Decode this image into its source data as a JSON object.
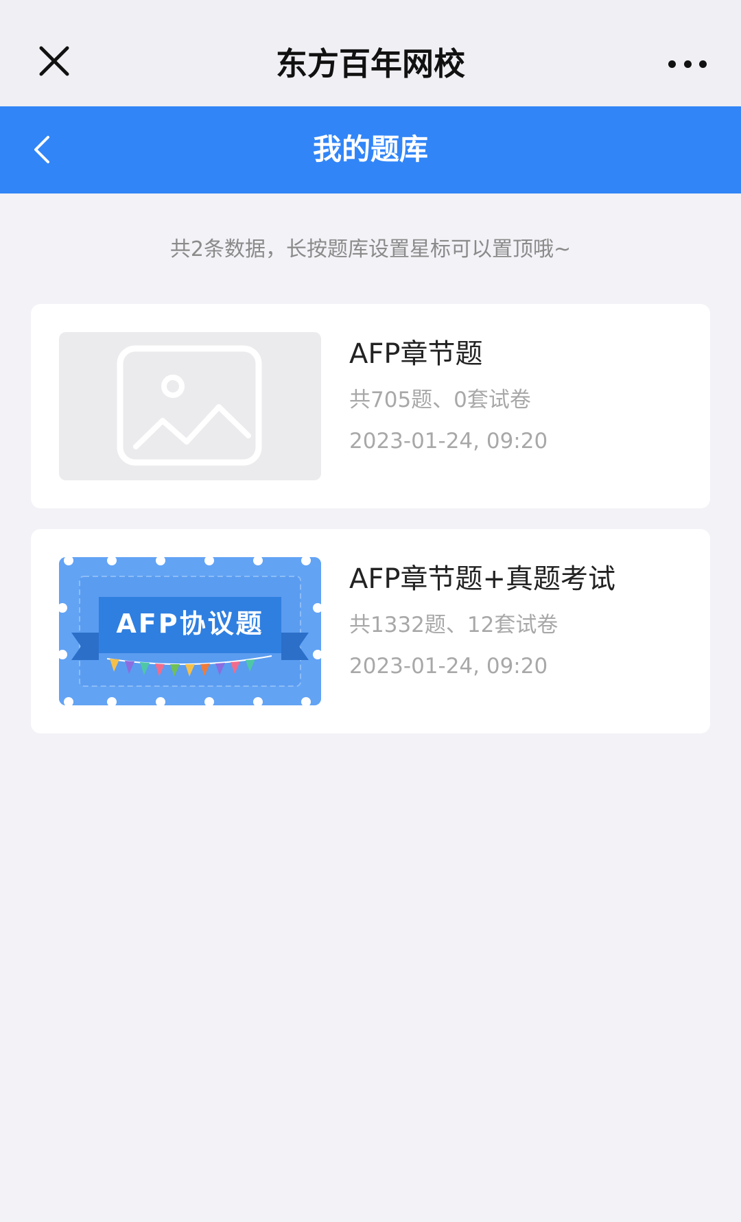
{
  "titlebar": {
    "title": "东方百年网校",
    "close_icon": "close-icon",
    "more_icon": "more-icon"
  },
  "navbar": {
    "title": "我的题库",
    "back_icon": "chevron-left-icon",
    "color": "#3185f7"
  },
  "hint": "共2条数据，长按题库设置星标可以置顶哦~",
  "banks": [
    {
      "title": "AFP章节题",
      "stats": "共705题、0套试卷",
      "date": "2023-01-24, 09:20",
      "thumbnail": "image-placeholder-icon"
    },
    {
      "title": "AFP章节题+真题考试",
      "stats": "共1332题、12套试卷",
      "date": "2023-01-24, 09:20",
      "thumbnail": "banner",
      "thumbnail_text": "AFP协议题"
    }
  ]
}
